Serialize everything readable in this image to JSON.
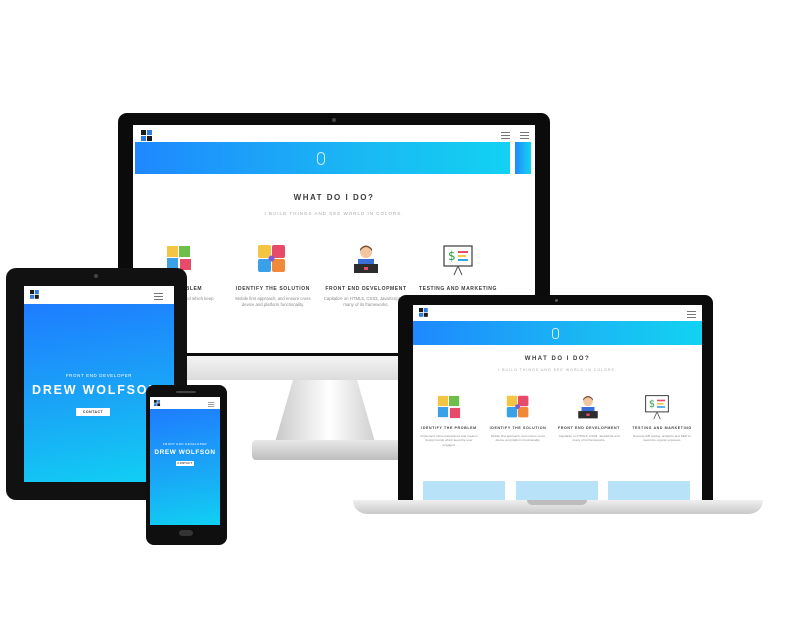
{
  "section": {
    "title": "WHAT DO I DO?",
    "subtitle": "I BUILD THINGS AND SEE WORLD IN COLORS."
  },
  "hero": {
    "label": "FRONT END DEVELOPER",
    "name": "DREW WOLFSON",
    "button": "CONTACT",
    "scroll_icon": "mouse-scroll-icon"
  },
  "features": [
    {
      "icon": "puzzle-pieces-icon",
      "title": "IDENTIFY THE PROBLEM",
      "desc": "Implement micro-interactions and modern design trends which keep the user engaged."
    },
    {
      "icon": "puzzle-square-icon",
      "title": "IDENTIFY THE SOLUTION",
      "desc": "Mobile first approach, and ensure cross device and platform functionality."
    },
    {
      "icon": "developer-at-laptop-icon",
      "title": "FRONT END DEVELOPMENT",
      "desc": "Capitalize on HTML5, CSS3, JavaScript and many of its frameworks."
    },
    {
      "icon": "dollar-presentation-board-icon",
      "title": "TESTING AND MARKETING",
      "desc": "Execute A/B testing, analytics and SEO to maximize organic exposure."
    }
  ],
  "imac_visible": {
    "f1_title": "PROBLEM",
    "f1_desc": "eractions and which keep the gaged."
  },
  "icons": {
    "logo": "logo-icon",
    "menu": "hamburger-menu-icon"
  },
  "colors": {
    "gradient_start": "#1e88ff",
    "gradient_end": "#12d2f2",
    "text_dark": "#3b3b3b",
    "text_muted": "#a8a8a8"
  }
}
